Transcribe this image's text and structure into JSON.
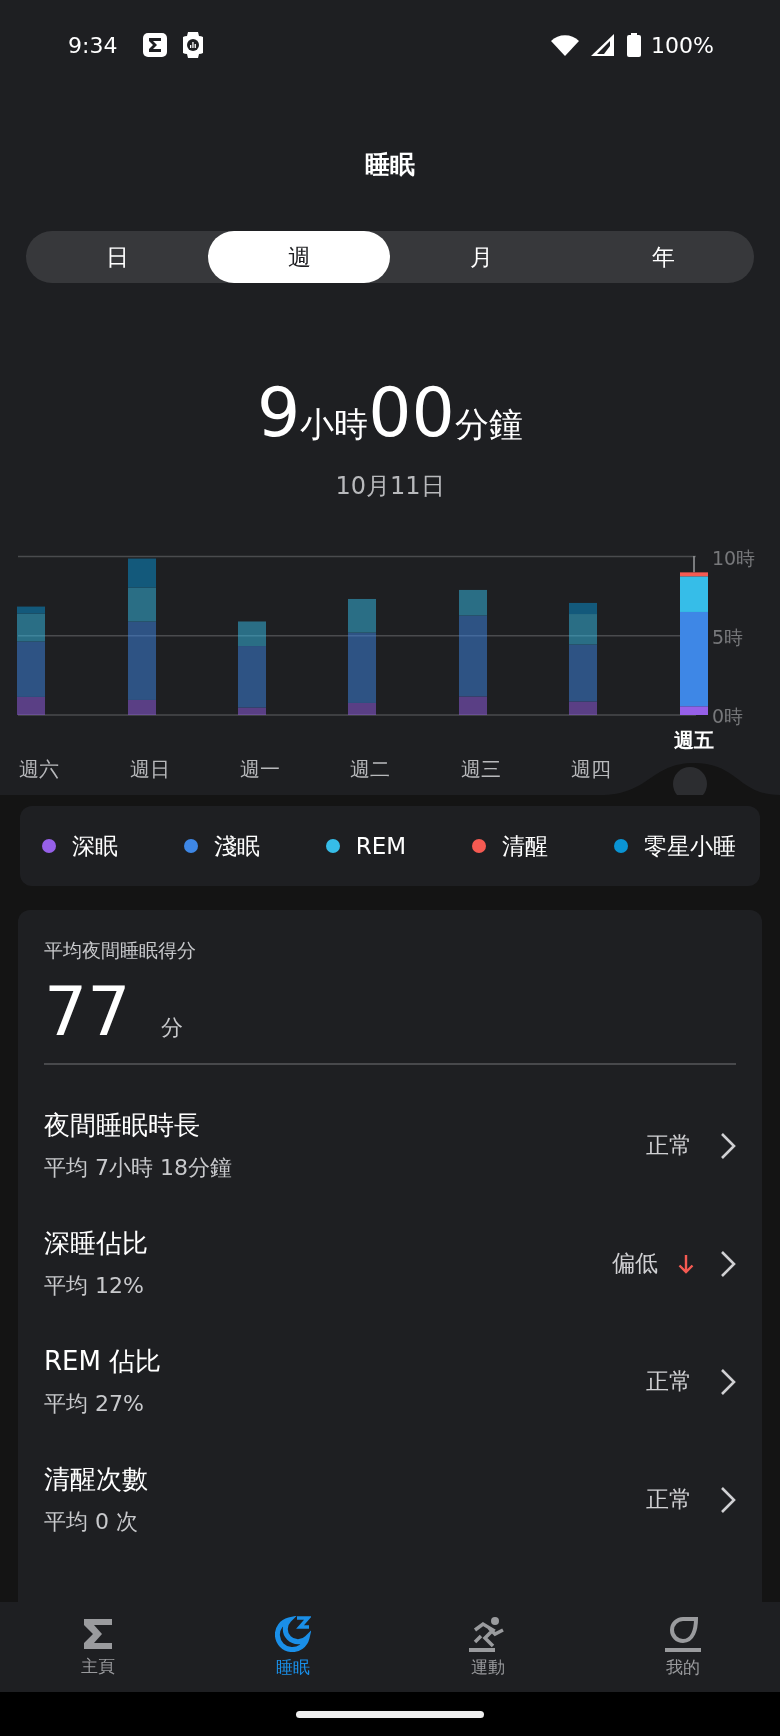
{
  "status_bar": {
    "time": "9:34",
    "battery": "100%"
  },
  "header": {
    "title": "睡眠"
  },
  "tabs": [
    {
      "label": "日",
      "selected": false
    },
    {
      "label": "週",
      "selected": true
    },
    {
      "label": "月",
      "selected": false
    },
    {
      "label": "年",
      "selected": false
    }
  ],
  "summary": {
    "hours": "9",
    "hours_unit": "小時",
    "minutes": "00",
    "minutes_unit": "分鐘",
    "date": "10月11日"
  },
  "chart": {
    "selected": [
      false,
      false,
      false,
      false,
      false,
      false,
      true
    ],
    "chart_data": {
      "type": "bar",
      "stacked": true,
      "categories": [
        "週六",
        "週日",
        "週一",
        "週二",
        "週三",
        "週四",
        "週五"
      ],
      "ylim": [
        0,
        10
      ],
      "yticks": [
        {
          "value": 0,
          "label": "0時"
        },
        {
          "value": 5,
          "label": "5時"
        },
        {
          "value": 10,
          "label": "10時"
        }
      ],
      "series": [
        {
          "name": "深眠",
          "color": "#9660e8",
          "values": [
            1.14,
            0.95,
            0.47,
            0.76,
            1.17,
            0.85,
            0.55
          ]
        },
        {
          "name": "淺眠",
          "color": "#3e87e6",
          "values": [
            3.5,
            4.95,
            3.88,
            4.44,
            5.11,
            3.6,
            5.95
          ]
        },
        {
          "name": "REM",
          "color": "#36bde8",
          "values": [
            1.76,
            2.14,
            1.55,
            2.12,
            1.61,
            1.92,
            2.25
          ]
        },
        {
          "name": "清醒",
          "color": "#f55a52",
          "values": [
            0,
            0,
            0,
            0,
            0,
            0,
            0.25
          ]
        },
        {
          "name": "零星小睡",
          "color": "#0a94d4",
          "values": [
            0.44,
            1.83,
            0,
            0,
            0,
            0.7,
            0
          ]
        }
      ]
    }
  },
  "score": {
    "label": "平均夜間睡眠得分",
    "value": "77",
    "unit": "分"
  },
  "rows": [
    {
      "title": "夜間睡眠時長",
      "subtitle": "平均 7小時 18分鐘",
      "status": "正常",
      "low": false
    },
    {
      "title": "深睡佔比",
      "subtitle": "平均 12%",
      "status": "偏低",
      "low": true
    },
    {
      "title": "REM 佔比",
      "subtitle": "平均 27%",
      "status": "正常",
      "low": false
    },
    {
      "title": "清醒次數",
      "subtitle": "平均 0 次",
      "status": "正常",
      "low": false
    }
  ],
  "nav": [
    {
      "label": "主頁",
      "selected": false
    },
    {
      "label": "睡眠",
      "selected": true
    },
    {
      "label": "運動",
      "selected": false
    },
    {
      "label": "我的",
      "selected": false
    }
  ]
}
